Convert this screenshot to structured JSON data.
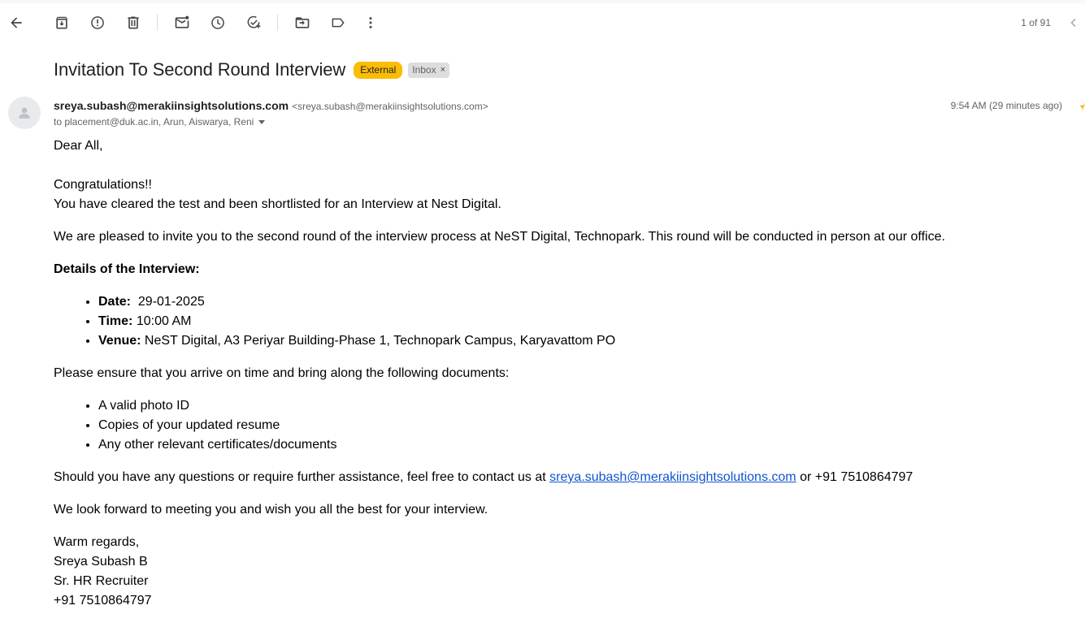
{
  "toolbar": {
    "buttons": [
      "back-icon",
      "archive-icon",
      "report-spam-icon",
      "delete-icon",
      "mark-unread-icon",
      "snooze-icon",
      "add-to-tasks-icon",
      "move-to-icon",
      "labels-icon",
      "more-vert-icon"
    ],
    "pager": "1 of 91"
  },
  "email": {
    "subject": "Invitation To Second Round Interview",
    "label_external": "External",
    "label_inbox": "Inbox",
    "label_inbox_remove": "×",
    "sender_name": "sreya.subash@merakiinsightsolutions.com",
    "sender_email": "<sreya.subash@merakiinsightsolutions.com>",
    "recipients": "to placement@duk.ac.in, Arun, Aiswarya, Reni",
    "time": "9:54 AM (29 minutes ago)"
  },
  "body": {
    "greeting": "Dear All,",
    "congrats": "Congratulations!!",
    "cleared": "You have cleared the test and been shortlisted for an Interview at Nest Digital.",
    "invite": "We are pleased to invite you to the second round of the interview process at NeST Digital, Technopark. This round will be conducted in person at our office.",
    "details_heading": "Details of the Interview:",
    "details": [
      {
        "label": "Date:",
        "value": "  29-01-2025"
      },
      {
        "label": "Time:",
        "value": " 10:00 AM"
      },
      {
        "label": "Venue:",
        "value": " NeST Digital, A3 Periyar Building-Phase 1, Technopark Campus, Karyavattom PO"
      }
    ],
    "ensure": "Please ensure that you arrive on time and bring along the following documents:",
    "documents": [
      "A valid photo ID",
      "Copies of your updated resume",
      "Any other relevant certificates/documents"
    ],
    "contact_prefix": "Should you have any questions or require further assistance, feel free to contact us at ",
    "contact_link": "sreya.subash@merakiinsightsolutions.com",
    "contact_suffix": " or +91 7510864797",
    "closing": "We look forward to meeting you and wish you all the best for your interview.",
    "signature": [
      "Warm regards,",
      "Sreya Subash B",
      "Sr. HR Recruiter",
      "+91 7510864797"
    ]
  }
}
